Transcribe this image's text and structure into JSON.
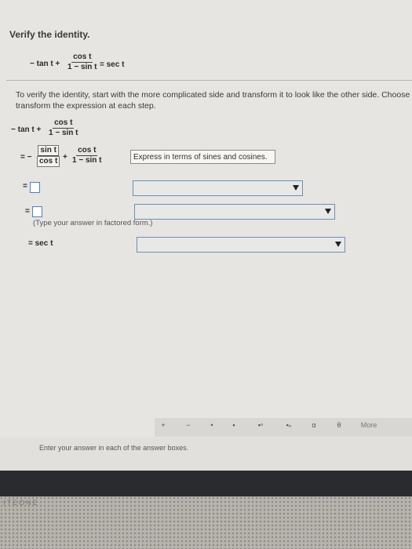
{
  "header": {
    "title": "Verify the identity."
  },
  "identity": {
    "prefix": "− tan t +",
    "num": "cos t",
    "den": "1 − sin t",
    "rhs": "= sec t"
  },
  "instructions": {
    "line1": "To verify the identity, start with the more complicated side and transform it to look like the other side. Choose t",
    "line2": "transform the expression at each step."
  },
  "steps": {
    "start": {
      "prefix": "− tan t +",
      "num": "cos t",
      "den": "1 − sin t"
    },
    "step1": {
      "eq": "= −",
      "f1_num": "sin t",
      "f1_den": "cos t",
      "plus": "+",
      "f2_num": "cos t",
      "f2_den": "1 − sin t",
      "reason": "Express in terms of sines and cosines."
    },
    "step2": {
      "eq": "="
    },
    "step3": {
      "eq": "=",
      "hint": "(Type your answer in factored form.)"
    },
    "step4": {
      "label": "= sec t"
    }
  },
  "toolbar": {
    "buttons": [
      "+",
      "−",
      "•",
      "▪",
      "▪ⁿ",
      "▪ₙ",
      "α",
      "θ"
    ],
    "more": "More"
  },
  "footer": {
    "enter_text": "Enter your answer in each of the answer boxes."
  },
  "device": {
    "brand": "ITEONE"
  }
}
